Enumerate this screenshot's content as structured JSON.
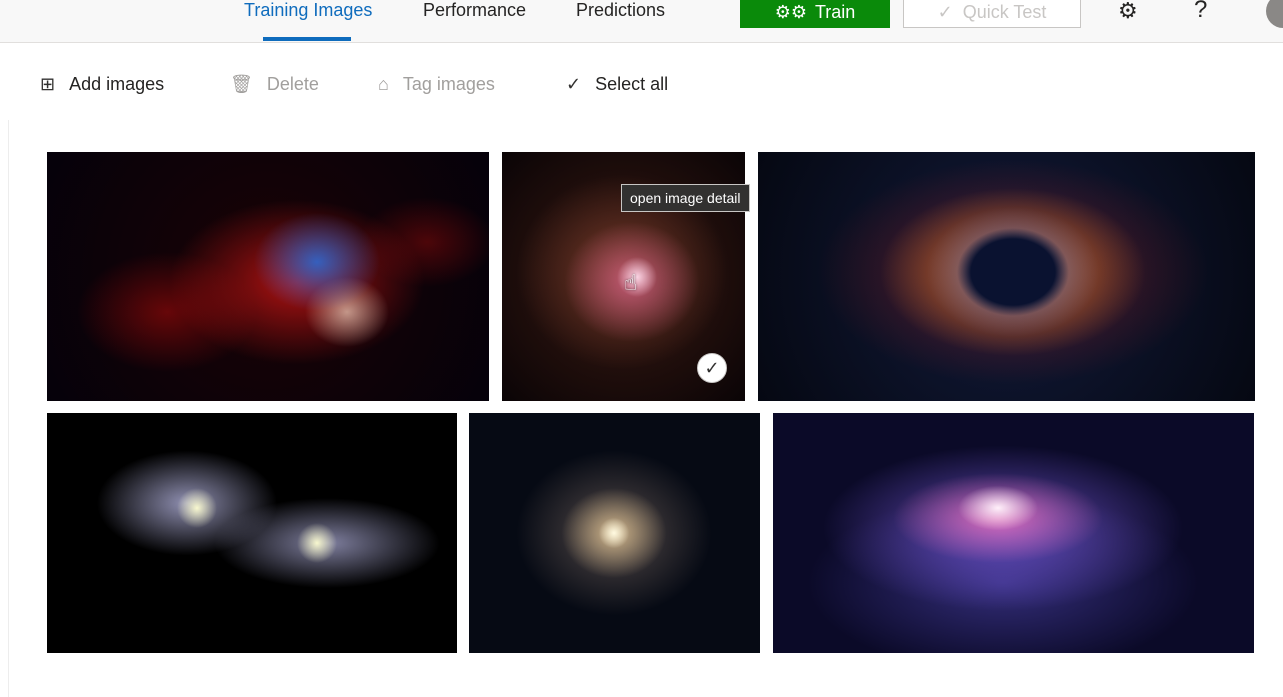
{
  "nav": {
    "tabs": [
      {
        "label": "Training Images",
        "active": true
      },
      {
        "label": "Performance",
        "active": false
      },
      {
        "label": "Predictions",
        "active": false
      }
    ],
    "train_label": "Train",
    "quick_test_label": "Quick Test",
    "icons": {
      "train": "gears-icon",
      "quick_test": "checkmark-icon",
      "settings": "gear-icon",
      "help": "help-icon"
    }
  },
  "commands": {
    "add_images": "Add images",
    "delete": "Delete",
    "tag_images": "Tag images",
    "select_all": "Select all"
  },
  "tooltip": "open image detail",
  "images": [
    {
      "subject": "nebula-red-blue",
      "selected": false
    },
    {
      "subject": "nebula-pink",
      "selected": true
    },
    {
      "subject": "helix-nebula",
      "selected": false
    },
    {
      "subject": "colliding-galaxies",
      "selected": false
    },
    {
      "subject": "spiral-galaxy-gold",
      "selected": false
    },
    {
      "subject": "milky-way-purple",
      "selected": false
    }
  ],
  "colors": {
    "accent_blue": "#0f6cbd",
    "train_green": "#0a8a0a"
  }
}
